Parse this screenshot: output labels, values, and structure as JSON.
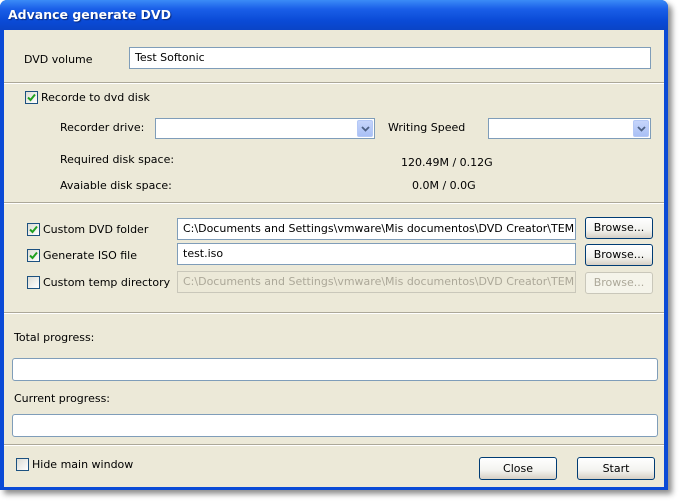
{
  "window": {
    "title": "Advance generate DVD"
  },
  "dvd_volume": {
    "label": "DVD volume",
    "value": "Test Softonic"
  },
  "record": {
    "checkbox_label": "Recorde to dvd disk",
    "checked": true,
    "recorder_drive_label": "Recorder drive:",
    "recorder_drive_value": "",
    "writing_speed_label": "Writing Speed",
    "writing_speed_value": "",
    "required_label": "Required disk space:",
    "required_value": "120.49M / 0.12G",
    "available_label": "Avaiable disk space:",
    "available_value": "0.0M / 0.0G"
  },
  "options": {
    "custom_folder": {
      "label": "Custom DVD folder",
      "checked": true,
      "value": "C:\\Documents and Settings\\vmware\\Mis documentos\\DVD Creator\\TEMP\\dv",
      "browse": "Browse..."
    },
    "iso_file": {
      "label": "Generate ISO file",
      "checked": true,
      "value": "test.iso",
      "browse": "Browse..."
    },
    "temp_dir": {
      "label": "Custom temp directory",
      "checked": false,
      "value": "C:\\Documents and Settings\\vmware\\Mis documentos\\DVD Creator\\TEMP\\ter",
      "browse": "Browse..."
    }
  },
  "progress": {
    "total_label": "Total progress:",
    "total": 0,
    "current_label": "Current progress:",
    "current": 0
  },
  "footer": {
    "hide_label": "Hide main window",
    "hide_checked": false,
    "close": "Close",
    "start": "Start"
  },
  "colors": {
    "title_bar": "#0a4ad6",
    "dialog_bg": "#ece9d8",
    "check_green": "#21a121"
  }
}
